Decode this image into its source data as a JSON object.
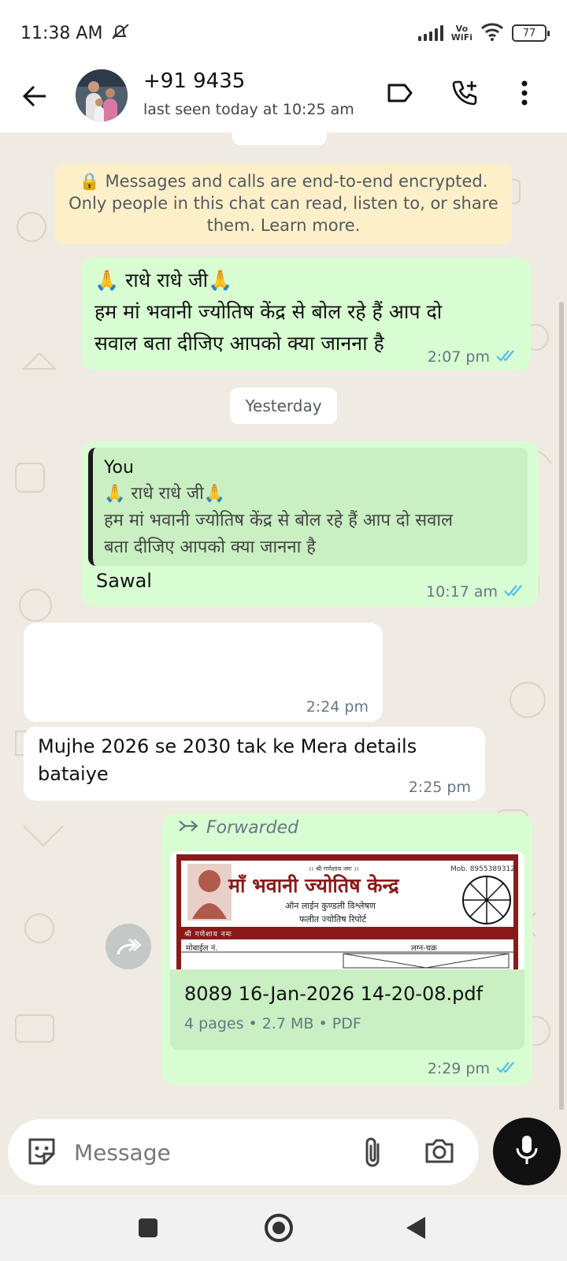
{
  "status_bar": {
    "time": "11:38 AM",
    "network_label": "Vo\nWiFi",
    "battery": "77"
  },
  "header": {
    "contact_name": "+91 9435",
    "last_seen": "last seen today at 10:25 am",
    "icons": [
      "back-arrow-icon",
      "label-icon",
      "add-call-icon",
      "more-icon"
    ]
  },
  "chat": {
    "encryption_notice": "🔒 Messages and calls are end-to-end encrypted. Only people in this chat can read, listen to, or share them. Learn more.",
    "date_separator": "Yesterday",
    "messages": [
      {
        "direction": "out",
        "line1": "🙏 राधे राधे जी🙏",
        "line2": "हम मां भवानी ज्योतिष केंद्र से बोल रहे हैं आप दो",
        "line3": "सवाल बता दीजिए आपको क्या जानना है",
        "time": "2:07 pm",
        "ticks": "read"
      },
      {
        "direction": "out",
        "quote_author": "You",
        "quote_line1": "🙏 राधे राधे जी🙏",
        "quote_line2": "हम मां भवानी ज्योतिष केंद्र से बोल रहे हैं आप दो सवाल",
        "quote_line3": "बता दीजिए आपको क्या जानना है",
        "text": "Sawal",
        "time": "10:17 am",
        "ticks": "read"
      },
      {
        "direction": "in",
        "text": "",
        "time": "2:24 pm"
      },
      {
        "direction": "in",
        "line1": "Mujhe 2026 se 2030 tak ke Mera details",
        "line2": "bataiye",
        "time": "2:25 pm"
      },
      {
        "direction": "out",
        "forwarded_label": "Forwarded",
        "preview": {
          "header_small": "।। श्री गणेशाय नमः ।।",
          "mobile": "Mob. 8955389312",
          "title": "माँ भवानी ज्योतिष केन्द्र",
          "subtitle1": "ऑन लाईन कुण्डली विश्लेषण",
          "subtitle2": "फलीत ज्योतिष रिपोर्ट",
          "strip": "श्री गणेशाय नमः",
          "left_label": "मोबाईल नं.",
          "right_label": "लग्न-चक्र"
        },
        "file_name": "8089 16-Jan-2026 14-20-08.pdf",
        "file_meta": "4 pages • 2.7 MB • PDF",
        "time": "2:29 pm",
        "ticks": "read"
      }
    ]
  },
  "input": {
    "placeholder": "Message"
  },
  "colors": {
    "outgoing_bubble": "#d9fdd3",
    "incoming_bubble": "#ffffff",
    "chat_background": "#efeae2",
    "read_tick": "#53bdeb"
  }
}
